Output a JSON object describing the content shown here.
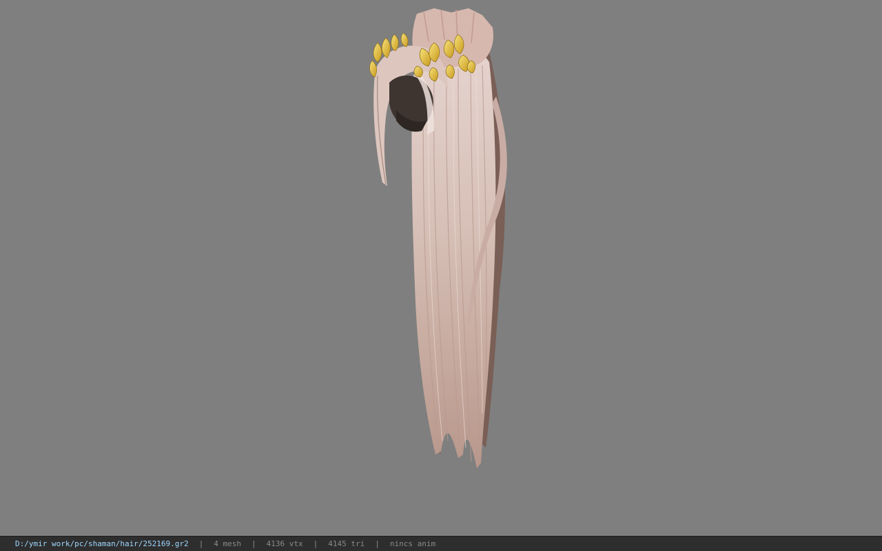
{
  "viewport": {
    "background": "#7f7f7f",
    "model_name": "hair model with golden leaf ornament"
  },
  "status_bar": {
    "file_path": "D:/ymir work/pc/shaman/hair/252169.gr2",
    "separator": "|",
    "mesh_count": "4 mesh",
    "vertex_count": "4136 vtx",
    "triangle_count": "4145 tri",
    "anim_status": "nincs anim",
    "colors": {
      "path": "#9fd7ff",
      "stats": "#8a8a8a",
      "background": "#2e2e2e"
    }
  }
}
